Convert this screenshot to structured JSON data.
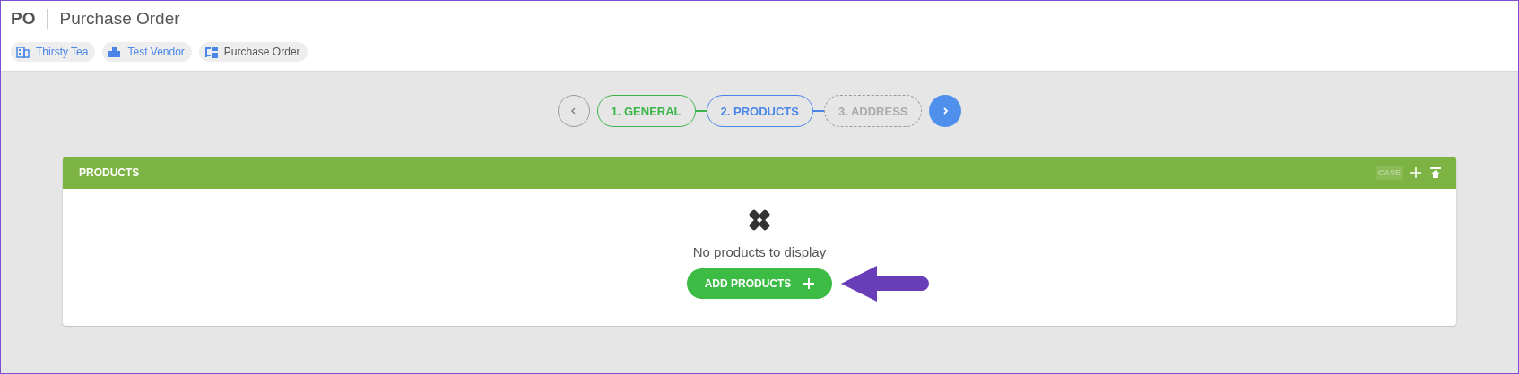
{
  "header": {
    "code": "PO",
    "title": "Purchase Order"
  },
  "chips": [
    {
      "kind": "company",
      "label": "Thirsty Tea"
    },
    {
      "kind": "vendor",
      "label": "Test Vendor"
    },
    {
      "kind": "document",
      "label": "Purchase Order"
    }
  ],
  "stepper": {
    "steps": [
      {
        "label": "1. GENERAL",
        "kind": "done"
      },
      {
        "label": "2. PRODUCTS",
        "kind": "current"
      },
      {
        "label": "3. ADDRESS",
        "kind": "pending"
      }
    ]
  },
  "panel": {
    "title": "PRODUCTS",
    "tools": [
      {
        "kind": "case",
        "label": "CASE",
        "disabled": true
      },
      {
        "kind": "add",
        "disabled": false
      },
      {
        "kind": "collapse",
        "disabled": false
      }
    ],
    "empty_message": "No products to display",
    "add_button": "ADD PRODUCTS"
  }
}
